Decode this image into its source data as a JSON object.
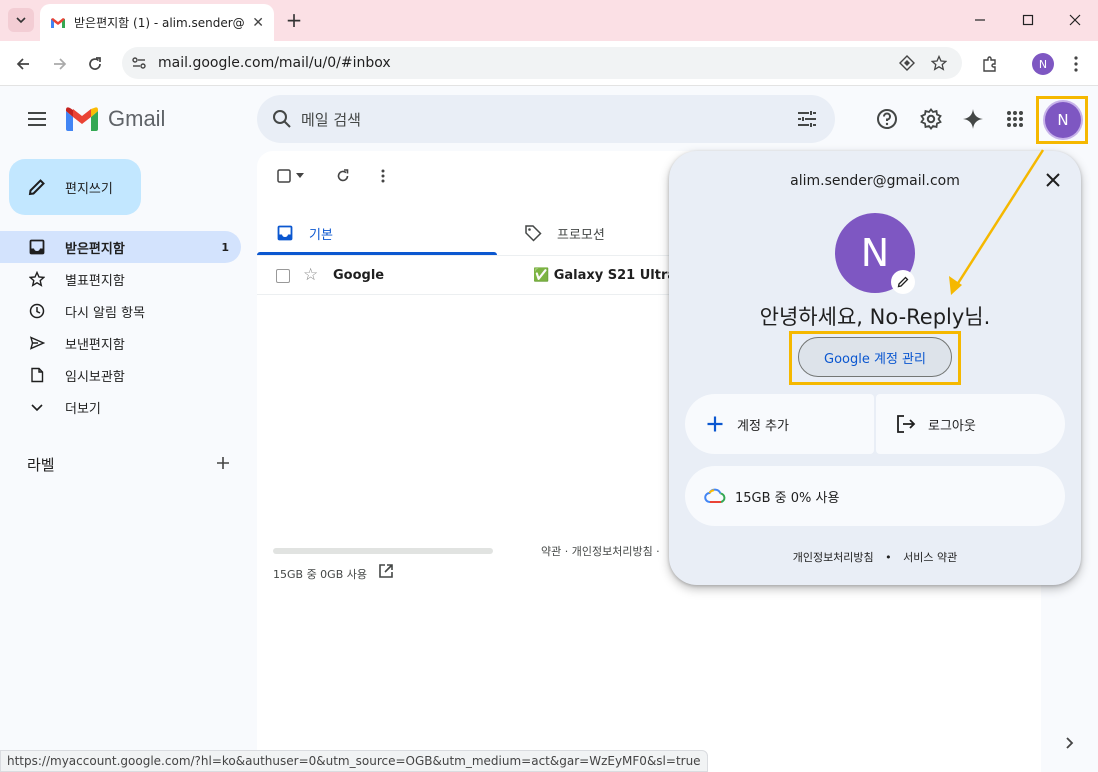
{
  "browser": {
    "tab_title": "받은편지함 (1) - alim.sender@",
    "url": "mail.google.com/mail/u/0/#inbox",
    "profile_initial": "N",
    "status_url": "https://myaccount.google.com/?hl=ko&authuser=0&utm_source=OGB&utm_medium=act&gar=WzEyMF0&sl=true"
  },
  "header": {
    "app_name": "Gmail",
    "search_placeholder": "메일 검색",
    "avatar_initial": "N"
  },
  "sidebar": {
    "compose_label": "편지쓰기",
    "items": [
      {
        "label": "받은편지함",
        "count": "1",
        "icon": "inbox-icon"
      },
      {
        "label": "별표편지함",
        "count": "",
        "icon": "star-icon"
      },
      {
        "label": "다시 알림 항목",
        "count": "",
        "icon": "clock-icon"
      },
      {
        "label": "보낸편지함",
        "count": "",
        "icon": "send-icon"
      },
      {
        "label": "임시보관함",
        "count": "",
        "icon": "draft-icon"
      },
      {
        "label": "더보기",
        "count": "",
        "icon": "chevron-down-icon"
      }
    ],
    "labels_title": "라벨"
  },
  "main": {
    "tabs": [
      {
        "label": "기본",
        "icon": "inbox-tab-icon"
      },
      {
        "label": "프로모션",
        "icon": "tag-icon"
      }
    ],
    "rows": [
      {
        "sender": "Google",
        "subject": "✅ Galaxy S21 Ultra"
      }
    ],
    "storage_text": "15GB 중 0GB 사용",
    "footer_links": "약관 · 개인정보처리방침 ·"
  },
  "account_popup": {
    "email": "alim.sender@gmail.com",
    "avatar_initial": "N",
    "greeting": "안녕하세요, No-Reply님.",
    "manage_label": "Google 계정 관리",
    "add_account_label": "계정 추가",
    "logout_label": "로그아웃",
    "storage_label": "15GB 중 0% 사용",
    "footer_privacy": "개인정보처리방침",
    "footer_separator": "•",
    "footer_terms": "서비스 약관"
  },
  "colors": {
    "highlight": "#f5b800",
    "accent": "#0b57d0",
    "avatar": "#7e57c2"
  }
}
